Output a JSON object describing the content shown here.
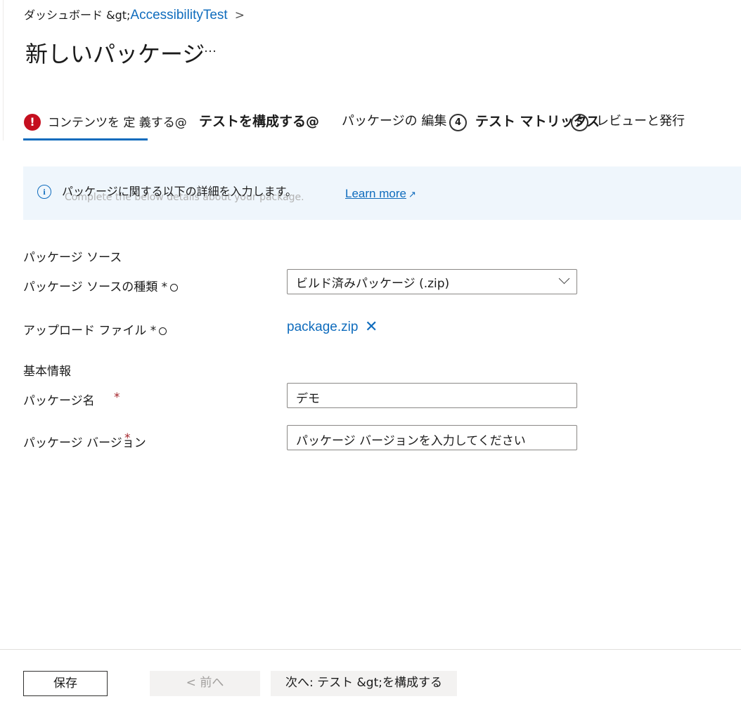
{
  "breadcrumb": {
    "prefix": "ダッシュボード &gt;",
    "link": "AccessibilityTest",
    "chevron": ">"
  },
  "page": {
    "title": "新しいパッケージ",
    "more": "…"
  },
  "tabs": [
    {
      "label": "コンテンツを 定 義する@",
      "status": "error",
      "icon": "!"
    },
    {
      "label": "テストを構成する@"
    },
    {
      "label": "パッケージの 編集"
    },
    {
      "label": "テスト マトリックス",
      "step": "4"
    },
    {
      "label": "レビューと発行",
      "step": "5"
    }
  ],
  "info_banner": {
    "icon": "info-icon",
    "text": "パッケージに関する以下の詳細を入力します。",
    "ghost_text": "Complete the below details about your package.",
    "learn_more": "Learn more"
  },
  "form": {
    "source_section": "パッケージ ソース",
    "source_type_label": "パッケージ ソースの種類 *",
    "source_type_value": "ビルド済みパッケージ (.zip)",
    "upload_label": "アップロード ファイル *",
    "uploaded_file": "package.zip",
    "basic_section": "基本情報",
    "name_label": "パッケージ名",
    "name_required": "*",
    "name_value": "デモ",
    "version_label": "パッケージ バージョン",
    "version_required": "*",
    "version_placeholder": "パッケージ バージョンを入力してください"
  },
  "footer": {
    "save": "保存",
    "prev": "< 前へ",
    "next": "次へ: テスト &gt;を構成する"
  },
  "colors": {
    "accent": "#0f6cbd",
    "error": "#c50f1f",
    "banner_bg": "#eff6fc"
  }
}
